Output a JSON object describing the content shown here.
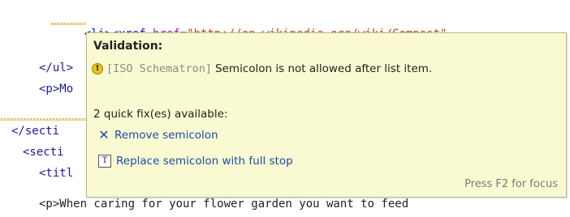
{
  "code": {
    "lines": [
      {
        "open": "<li>",
        "tag2": "<xref ",
        "attr": "href",
        "eq": "=",
        "val": "\"http://en.wikipedia.org/wiki/Compost\""
      },
      {
        "text": "</ul>"
      },
      {
        "text": "<p>Mo"
      },
      {
        "text": "</secti"
      },
      {
        "text": "<secti"
      },
      {
        "text": "<titl"
      },
      {
        "text": "<p>When caring for your flower garden you want to feed"
      }
    ]
  },
  "tooltip": {
    "title": "Validation:",
    "warning_icon": "warning-icon",
    "source": "[ISO Schematron]",
    "message": "Semicolon is not allowed after list item.",
    "fix_count": "2 quick fix(es) available:",
    "fixes": [
      {
        "icon": "remove-icon",
        "label": "Remove semicolon"
      },
      {
        "icon": "replace-text-icon",
        "label": "Replace semicolon with full stop"
      }
    ],
    "focus_hint": "Press F2 for focus"
  },
  "colors": {
    "tooltip_bg": "#fafad2",
    "link": "#1a4ea6",
    "tag": "#1c1c8c",
    "attribute": "#8b2a8b",
    "value": "#b1471d"
  }
}
